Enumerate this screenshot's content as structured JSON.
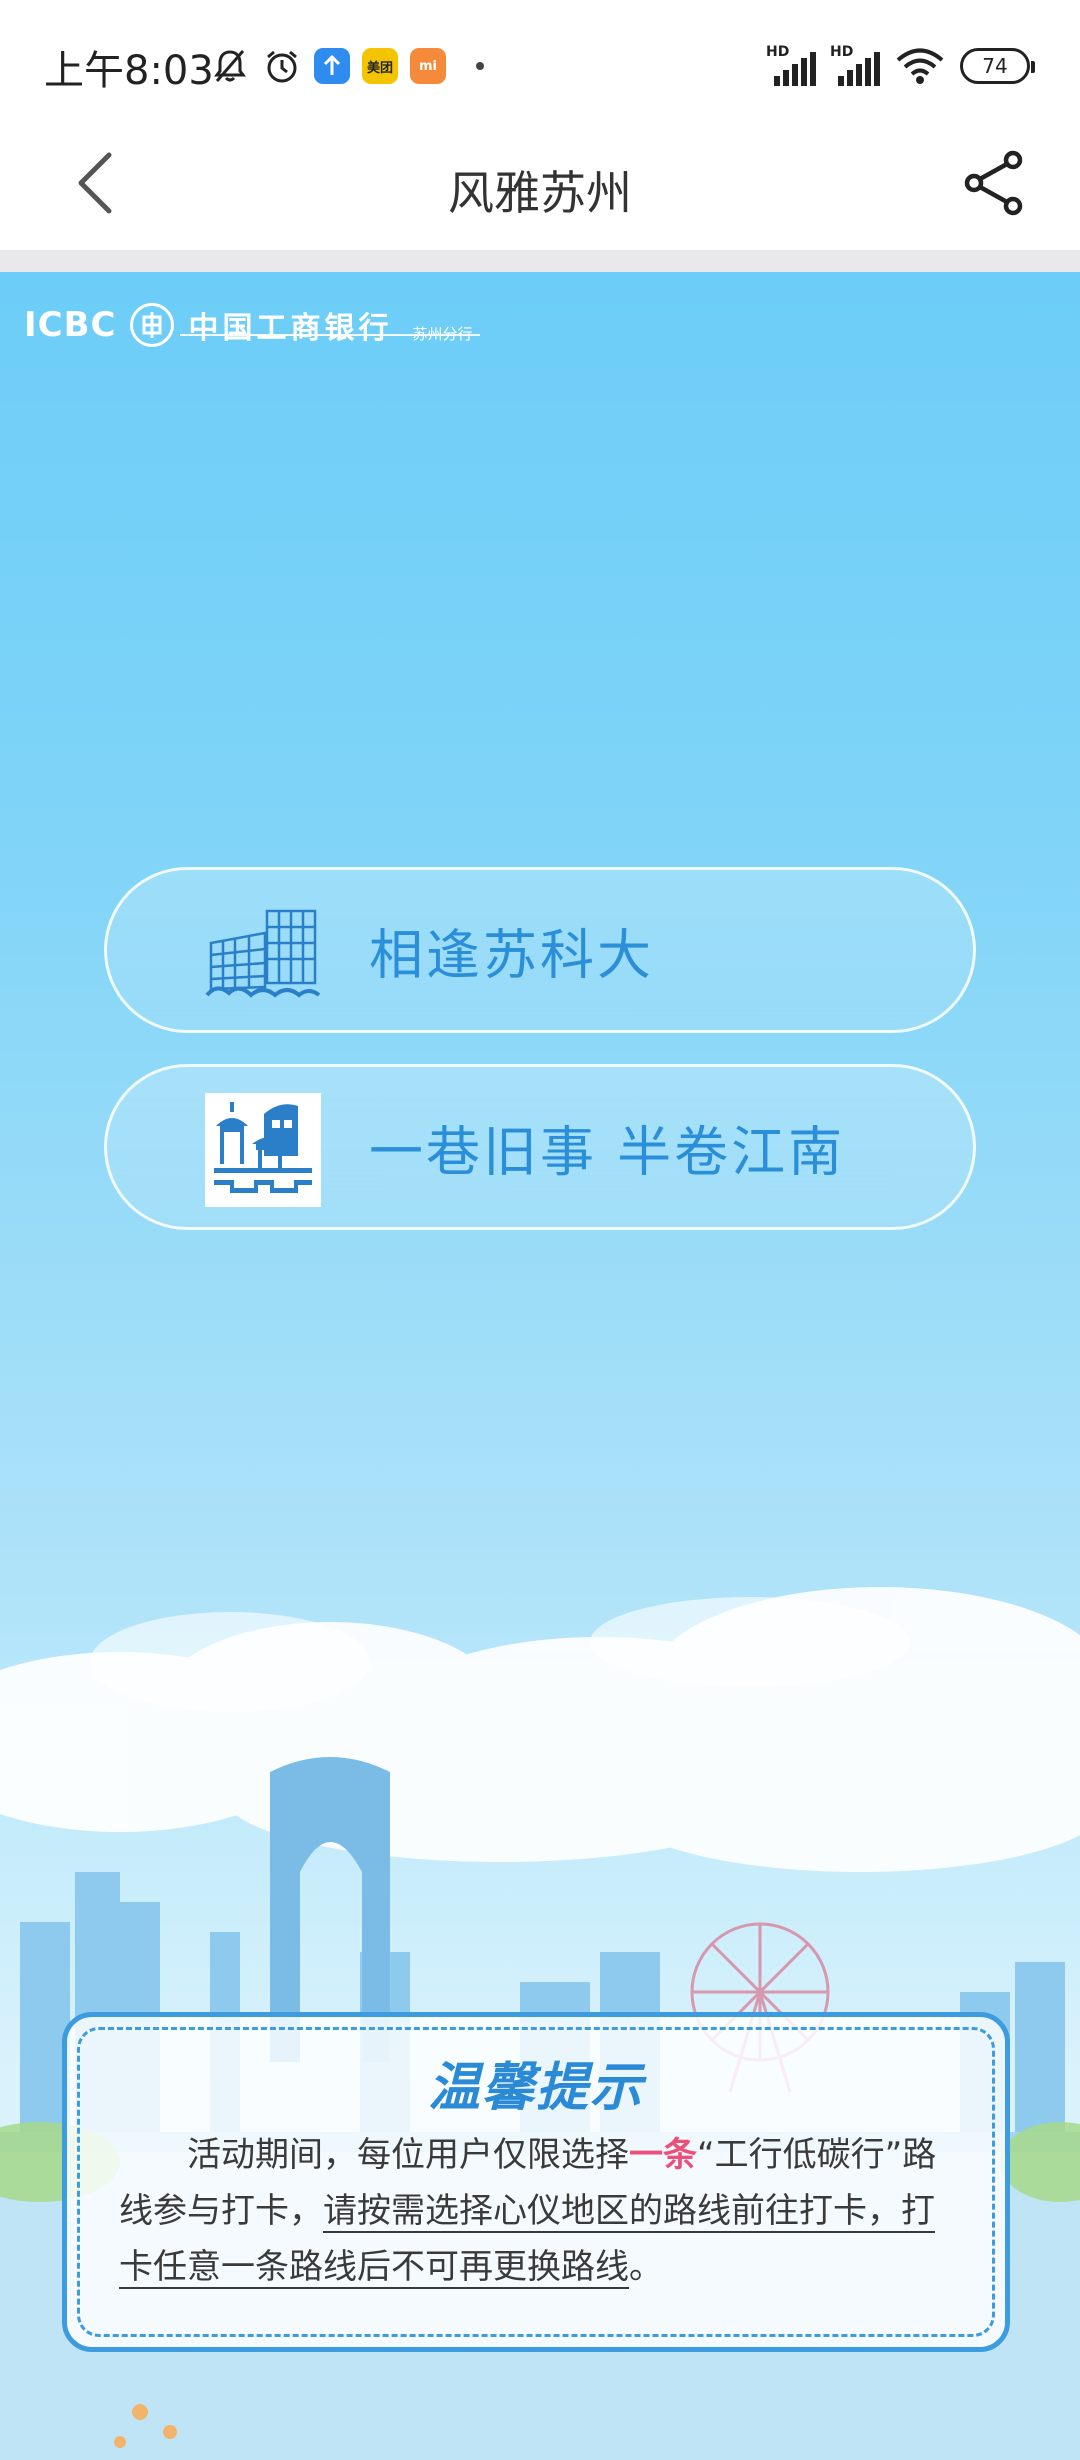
{
  "status_bar": {
    "time": "上午8:03",
    "apps": [
      {
        "name": "上",
        "color": "#2e8cf0"
      },
      {
        "name": "美团",
        "color": "#f5c400"
      },
      {
        "name": "mi",
        "color": "#f58a3a"
      }
    ],
    "battery": "74",
    "signal_tag": "HD"
  },
  "header": {
    "title": "风雅苏州"
  },
  "banner": {
    "logo_icbc": "ICBC",
    "logo_bank": "中国工商银行",
    "logo_branch": "苏州分行",
    "routes": [
      {
        "label": "相逢苏科大"
      },
      {
        "label": "一巷旧事 半卷江南"
      }
    ]
  },
  "notice": {
    "title": "温馨提示",
    "body_part1": "活动期间，每位用户仅限选择",
    "body_highlight": "一条",
    "body_part2": "“工行低碳行”路线参与打卡，",
    "body_underlined": "请按需选择心仪地区的路线前往打卡，打卡任意一条路线后不可再更换路线",
    "body_end": "。"
  },
  "colors": {
    "accent": "#2a8fd8",
    "highlight": "#ec4f7a",
    "sky_top": "#6ccdf8"
  }
}
